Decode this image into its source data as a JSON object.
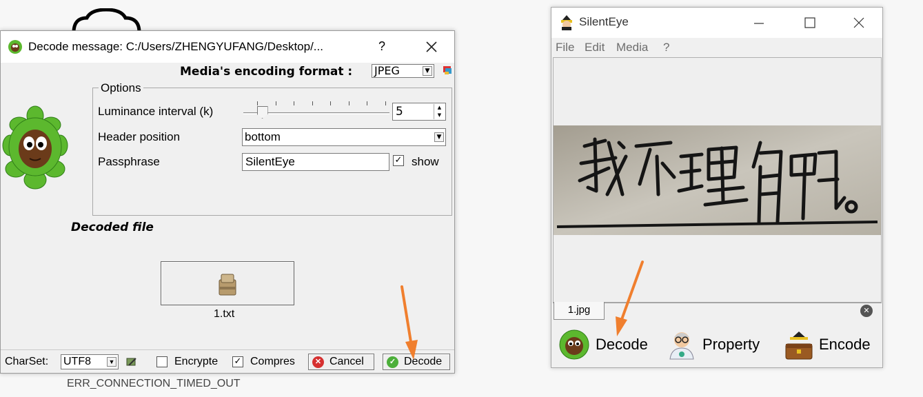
{
  "background": {
    "error_text": "ERR_CONNECTION_TIMED_OUT"
  },
  "decode_dialog": {
    "title": "Decode message: C:/Users/ZHENGYUFANG/Desktop/...",
    "help": "?",
    "encoding_format_label": "Media's encoding format :",
    "encoding_format_value": "JPEG",
    "options": {
      "legend": "Options",
      "luminance_label": "Luminance interval (k)",
      "luminance_value": "5",
      "luminance_slider_level": 0.1,
      "header_position_label": "Header position",
      "header_position_value": "bottom",
      "passphrase_label": "Passphrase",
      "passphrase_value": "SilentEye",
      "show_label": "show",
      "show_checked": true
    },
    "decoded_file_label": "Decoded file",
    "decoded_file_name": "1.txt",
    "status": {
      "charset_label": "CharSet:",
      "charset_value": "UTF8",
      "encrypted_label": "Encrypte",
      "encrypted_checked": false,
      "compressed_label": "Compres",
      "compressed_checked": true,
      "cancel_label": "Cancel",
      "decode_label": "Decode"
    }
  },
  "main_window": {
    "title": "SilentEye",
    "menu": [
      "File",
      "Edit",
      "Media",
      "?"
    ],
    "tab_label": "1.jpg",
    "buttons": {
      "decode": "Decode",
      "property": "Property",
      "encode": "Encode"
    }
  },
  "colors": {
    "arrow": "#f07f2e",
    "leaf_green": "#5cb82e",
    "cancel_red": "#d63030",
    "decode_green": "#4caf3a"
  }
}
